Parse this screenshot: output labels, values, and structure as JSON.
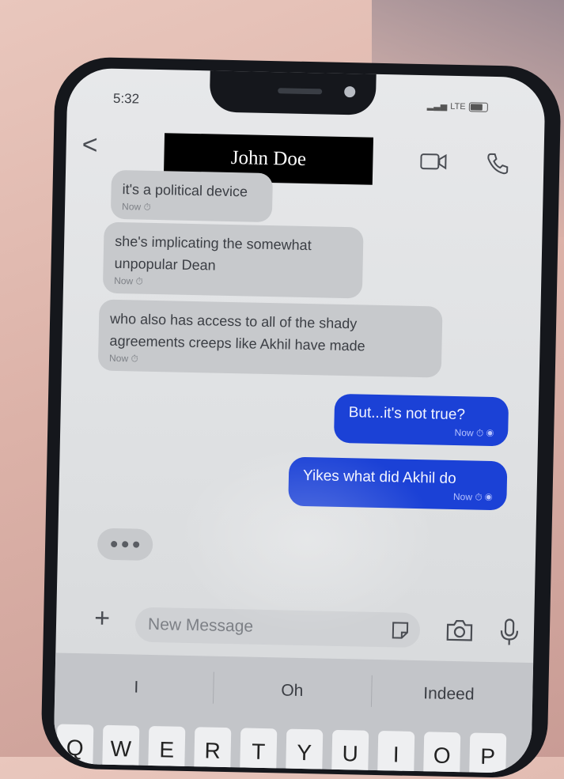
{
  "status": {
    "time": "5:32",
    "network": "LTE"
  },
  "header": {
    "contact_name": "John Doe",
    "back_glyph": "<"
  },
  "messages": [
    {
      "direction": "in",
      "text": "it's a political device",
      "meta": "Now"
    },
    {
      "direction": "in",
      "text": "she's implicating the somewhat unpopular Dean",
      "meta": "Now"
    },
    {
      "direction": "in",
      "text": "who also has access to all of the shady agreements creeps like Akhil have made",
      "meta": "Now"
    },
    {
      "direction": "out",
      "text": "But...it's not true?",
      "meta": "Now"
    },
    {
      "direction": "out",
      "text": "Yikes what did Akhil do",
      "meta": "Now"
    }
  ],
  "composer": {
    "placeholder": "New Message",
    "plus_glyph": "+"
  },
  "keyboard": {
    "suggestions": [
      "I",
      "Oh",
      "Indeed"
    ],
    "keys": [
      "Q",
      "W",
      "E",
      "R",
      "T",
      "Y",
      "U",
      "I",
      "O",
      "P"
    ]
  },
  "colors": {
    "outgoing_bubble": "#1b41d6",
    "incoming_bubble": "#c7c9cc"
  },
  "icons": [
    "video-call-icon",
    "phone-call-icon",
    "sticker-icon",
    "camera-icon",
    "microphone-icon",
    "clock-icon",
    "read-receipt-icon"
  ]
}
